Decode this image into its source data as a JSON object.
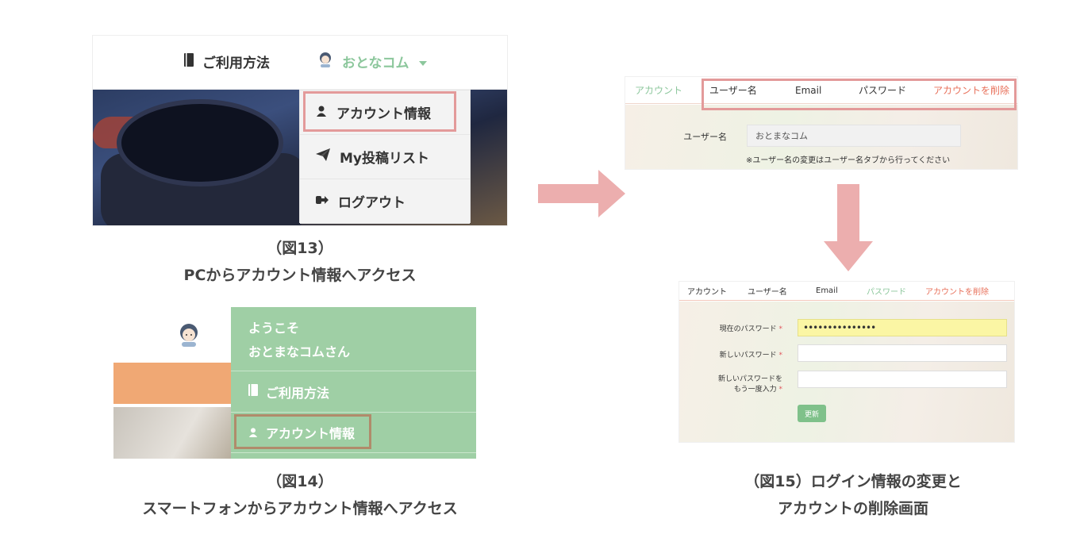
{
  "fig13": {
    "nav_help_label": "ご利用方法",
    "nav_user_label": "おとなコム",
    "dropdown": {
      "account_info": "アカウント情報",
      "my_posts": "My投稿リスト",
      "logout": "ログアウト"
    },
    "caption_line1": "（図13）",
    "caption_line2": "PCからアカウント情報へアクセス"
  },
  "fig14": {
    "welcome_line1": "ようこそ",
    "welcome_line2": "おとまなコムさん",
    "menu_help": "ご利用方法",
    "menu_account": "アカウント情報",
    "caption_line1": "（図14）",
    "caption_line2": "スマートフォンからアカウント情報へアクセス"
  },
  "fig15_top": {
    "tabs": {
      "account": "アカウント",
      "username": "ユーザー名",
      "email": "Email",
      "password": "パスワード",
      "delete": "アカウントを削除"
    },
    "username_label": "ユーザー名",
    "username_value": "おとまなコム",
    "note": "※ユーザー名の変更はユーザー名タブから行ってください"
  },
  "fig15_bottom": {
    "tabs": {
      "account": "アカウント",
      "username": "ユーザー名",
      "email": "Email",
      "password": "パスワード",
      "delete": "アカウントを削除"
    },
    "current_password_label": "現在のパスワード",
    "current_password_value": "•••••••••••••••",
    "new_password_label": "新しいパスワード",
    "confirm_password_label_line1": "新しいパスワードを",
    "confirm_password_label_line2": "もう一度入力",
    "required_mark": "*",
    "update_button": "更新"
  },
  "fig15_caption_line1": "（図15）ログイン情報の変更と",
  "fig15_caption_line2": "アカウントの削除画面",
  "colors": {
    "green": "#8cc79c",
    "menu_green": "#9fcfa5",
    "red_tab": "#e8705a",
    "highlight_pink": "#e39a9a",
    "arrow_pink": "#ecaeae"
  }
}
